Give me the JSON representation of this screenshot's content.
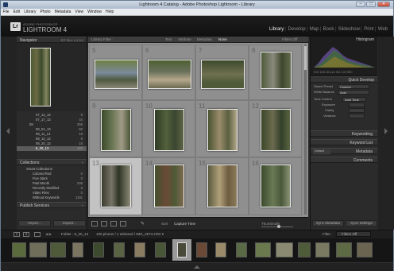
{
  "window": {
    "title": "Lightroom 4 Catalog - Adobe Photoshop Lightroom - Library",
    "min_label": "–",
    "max_label": "□",
    "close_label": "✕"
  },
  "menu": [
    "File",
    "Edit",
    "Library",
    "Photo",
    "Metadata",
    "View",
    "Window",
    "Help"
  ],
  "brand": {
    "badge": "Lr",
    "small": "ADOBE PHOTOSHOP",
    "big": "LIGHTROOM 4"
  },
  "modules": [
    "Library",
    "Develop",
    "Map",
    "Book",
    "Slideshow",
    "Print",
    "Web"
  ],
  "active_module": "Library",
  "left_panel": {
    "navigator_label": "Navigator",
    "navigator_zoom": "FIT   FILL   1:1   3:1",
    "folders": [
      {
        "name": "07_14_13",
        "count": "8"
      },
      {
        "name": "07_17_13",
        "count": "44"
      },
      {
        "name": "08",
        "count": "359"
      },
      {
        "name": "08_01_13",
        "count": "60"
      },
      {
        "name": "08_11_13",
        "count": "19"
      },
      {
        "name": "08_13_13",
        "count": "6"
      },
      {
        "name": "08_20_13",
        "count": "15"
      },
      {
        "name": "8_30_13",
        "count": "100",
        "selected": true
      }
    ],
    "collections_label": "Collections",
    "collections": [
      {
        "name": "Smart Collections",
        "count": ""
      },
      {
        "name": "Colored Red",
        "count": "0"
      },
      {
        "name": "Five Stars",
        "count": "0"
      },
      {
        "name": "Past Month",
        "count": "206"
      },
      {
        "name": "Recently Modified",
        "count": "0"
      },
      {
        "name": "Video Files",
        "count": "0"
      },
      {
        "name": "Without Keywords",
        "count": "1191"
      }
    ],
    "publish_label": "Publish Services",
    "import_button": "Import...",
    "export_button": "Export..."
  },
  "grid": {
    "filter_title": "Library Filter :",
    "filter_tabs": [
      "Text",
      "Attribute",
      "Metadata",
      "None"
    ],
    "filter_right": "Filters Off",
    "cell_numbers": [
      "5",
      "6",
      "7",
      "8",
      "9",
      "10",
      "11",
      "12",
      "13",
      "14",
      "15",
      "16"
    ],
    "selected_cell": "13"
  },
  "toolbar": {
    "sort_label": "Sort",
    "sort_value": "Capture Time",
    "thumbnails_label": "Thumbnails"
  },
  "right_panel": {
    "histogram_label": "Histogram",
    "histogram_meta": "ISO 100   40 mm   f/11   1/3 SEC",
    "quick_develop_label": "Quick Develop",
    "saved_preset_label": "Saved Preset",
    "saved_preset_value": "Custom",
    "white_balance_label": "White Balance",
    "white_balance_value": "Auto",
    "tone_control_label": "Tone Control",
    "tone_control_value": "Auto Tone",
    "tone_rows": [
      "Exposure",
      "Clarity",
      "Vibrance"
    ],
    "keywording_label": "Keywording",
    "keyword_list_label": "Keyword List",
    "metadata_label": "Metadata",
    "metadata_preset": "Default",
    "comments_label": "Comments",
    "sync_metadata": "Sync Metadata",
    "sync_settings": "Sync Settings"
  },
  "filmstrip": {
    "nav_1": "1",
    "nav_2": "2",
    "source": "Folder : 8_30_13",
    "info": "100 photos / 1 selected / IMG_2574.CR2 ▾",
    "filter_label": "Filter :",
    "filter_value": "Filters Off"
  },
  "colors": {
    "accent": "#f0f0f0",
    "panel": "#2b2b2b",
    "grid_bg": "#8f8f8f",
    "selected_cell": "#c3c3c3"
  }
}
